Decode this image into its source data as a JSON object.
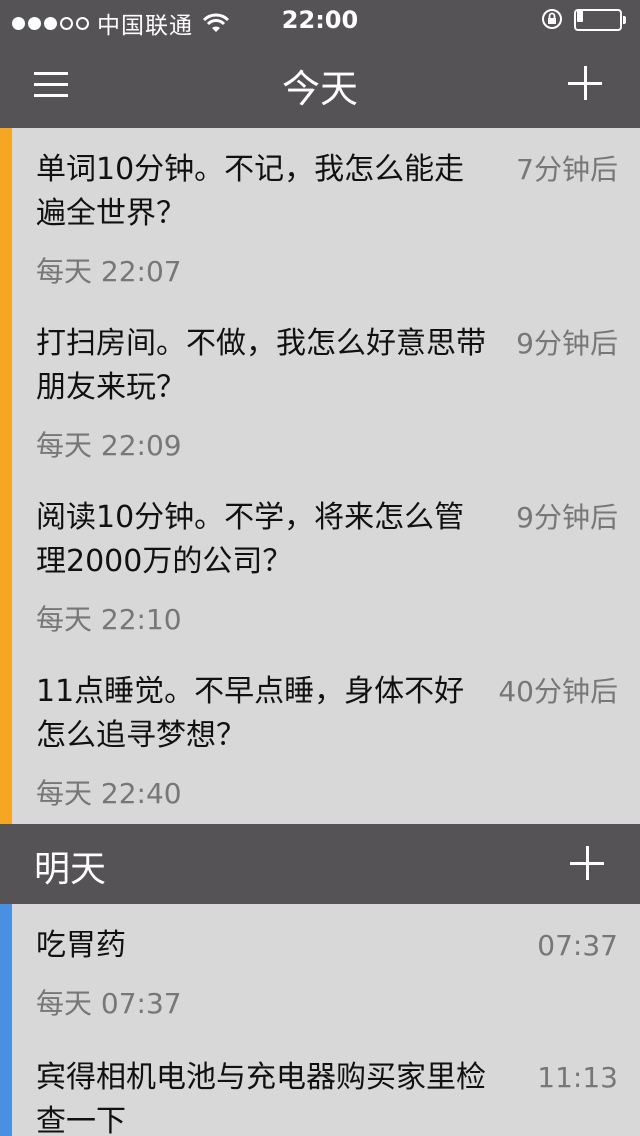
{
  "status_bar": {
    "carrier": "中国联通",
    "time": "22:00",
    "signal_filled": 3,
    "signal_total": 5,
    "battery_level": 0.15
  },
  "nav": {
    "title": "今天",
    "menu_icon": "hamburger-icon",
    "add_icon": "plus-icon"
  },
  "today": {
    "accent_color": "#f5a623",
    "items": [
      {
        "title": "单词10分钟。不记，我怎么能走遍全世界？",
        "schedule": "每天 22:07",
        "when": "7分钟后"
      },
      {
        "title": "打扫房间。不做，我怎么好意思带朋友来玩？",
        "schedule": "每天 22:09",
        "when": "9分钟后"
      },
      {
        "title": "阅读10分钟。不学，将来怎么管理2000万的公司？",
        "schedule": "每天 22:10",
        "when": "9分钟后"
      },
      {
        "title": "11点睡觉。不早点睡，身体不好怎么追寻梦想？",
        "schedule": "每天 22:40",
        "when": "40分钟后"
      }
    ]
  },
  "tomorrow": {
    "title": "明天",
    "accent_color": "#4a90e2",
    "items": [
      {
        "title": "吃胃药",
        "schedule": "每天 07:37",
        "when": "07:37"
      },
      {
        "title": "宾得相机电池与充电器购买家里检查一下",
        "schedule": "",
        "when": "11:13"
      }
    ]
  }
}
